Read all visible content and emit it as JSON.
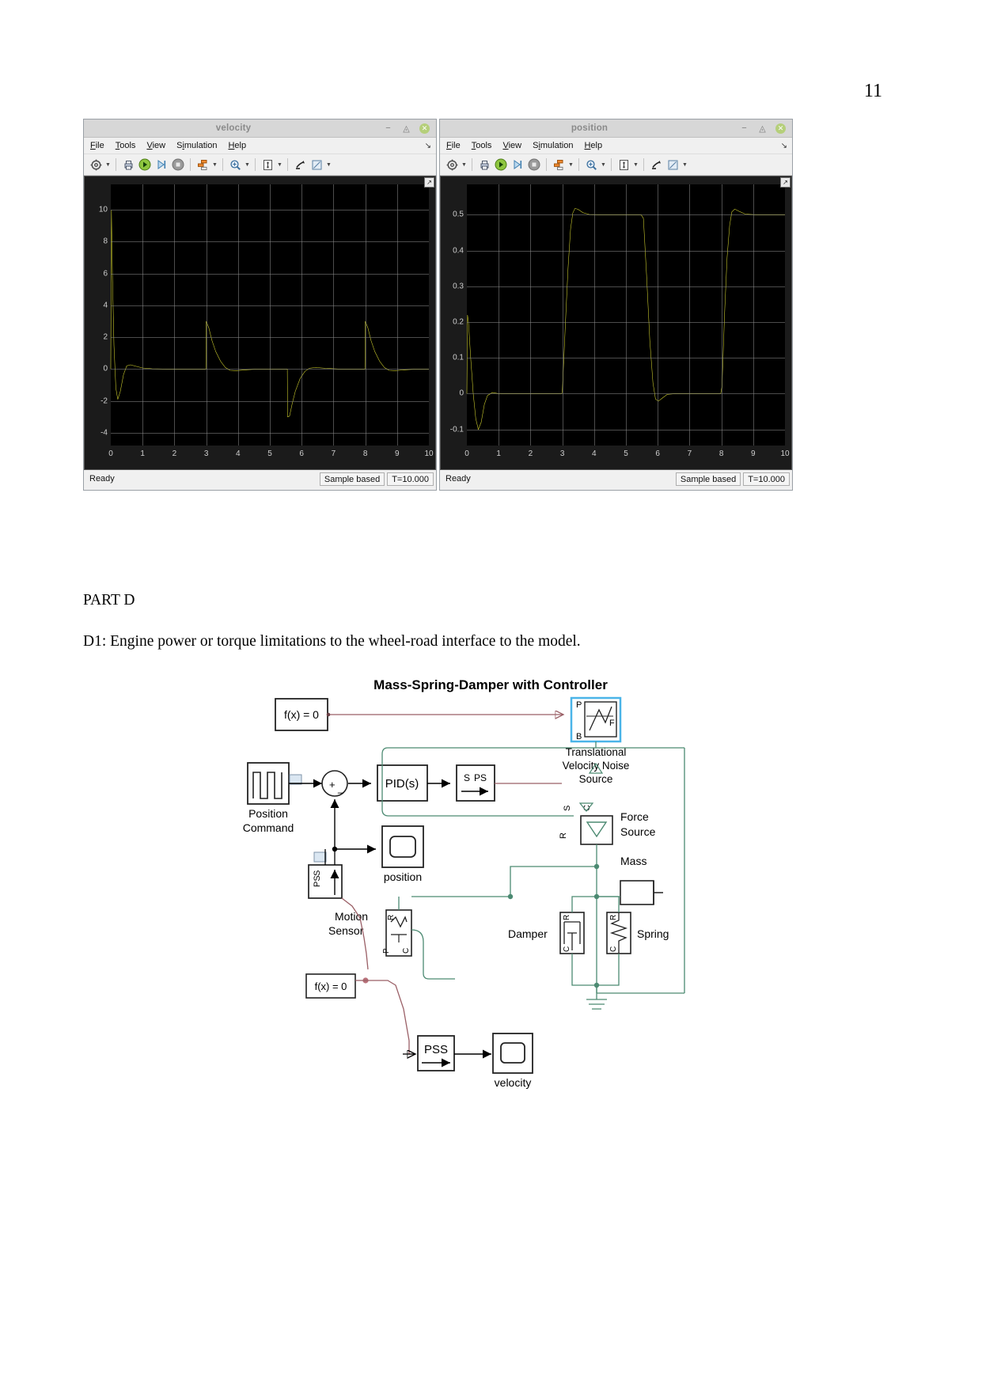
{
  "page": {
    "number": "11"
  },
  "document": {
    "part_heading": "PART D",
    "d1_text": "D1: Engine power or torque limitations to the wheel-road interface to the model."
  },
  "scopes": [
    {
      "id": "velocity",
      "title": "velocity",
      "menu": [
        "File",
        "Tools",
        "View",
        "Simulation",
        "Help"
      ],
      "toolbar_icons": [
        "settings-gear-icon",
        "print-icon",
        "run-icon",
        "step-forward-icon",
        "stop-icon",
        "layout-icon",
        "zoom-in-icon",
        "autoscale-icon",
        "cursor-measure-icon",
        "measurement-icon"
      ],
      "status": {
        "ready": "Ready",
        "sample_mode": "Sample based",
        "time": "T=10.000"
      },
      "window_buttons": [
        "minimize",
        "restore",
        "close"
      ],
      "chart_data": {
        "type": "line",
        "title": "velocity",
        "xlabel": "",
        "ylabel": "",
        "xlim": [
          0,
          10
        ],
        "ylim": [
          -4.8,
          11.6
        ],
        "xticks": [
          0,
          1,
          2,
          3,
          4,
          5,
          6,
          7,
          8,
          9,
          10
        ],
        "yticks": [
          -4,
          -2,
          0,
          2,
          4,
          6,
          8,
          10
        ],
        "grid": true,
        "line_color": "#d8d830",
        "background": "#000000",
        "series": [
          {
            "name": "velocity",
            "points": [
              [
                0.0,
                0.0
              ],
              [
                0.02,
                10.0
              ],
              [
                0.05,
                6.0
              ],
              [
                0.1,
                1.5
              ],
              [
                0.16,
                -1.2
              ],
              [
                0.22,
                -1.9
              ],
              [
                0.3,
                -1.4
              ],
              [
                0.4,
                -0.35
              ],
              [
                0.5,
                0.2
              ],
              [
                0.62,
                0.27
              ],
              [
                0.78,
                0.18
              ],
              [
                1.0,
                0.07
              ],
              [
                1.3,
                0.02
              ],
              [
                1.8,
                0.0
              ],
              [
                2.5,
                0.0
              ],
              [
                2.99,
                0.0
              ],
              [
                3.0,
                3.0
              ],
              [
                3.08,
                2.6
              ],
              [
                3.18,
                1.8
              ],
              [
                3.3,
                1.1
              ],
              [
                3.45,
                0.5
              ],
              [
                3.6,
                0.1
              ],
              [
                3.75,
                -0.08
              ],
              [
                3.95,
                -0.1
              ],
              [
                4.2,
                -0.05
              ],
              [
                4.6,
                0.0
              ],
              [
                5.4,
                0.0
              ],
              [
                5.55,
                0.0
              ],
              [
                5.56,
                -3.0
              ],
              [
                5.62,
                -2.95
              ],
              [
                5.7,
                -2.2
              ],
              [
                5.8,
                -1.4
              ],
              [
                5.95,
                -0.6
              ],
              [
                6.1,
                -0.15
              ],
              [
                6.25,
                0.06
              ],
              [
                6.45,
                0.1
              ],
              [
                6.75,
                0.05
              ],
              [
                7.2,
                0.0
              ],
              [
                7.9,
                0.0
              ],
              [
                7.99,
                0.0
              ],
              [
                8.0,
                3.0
              ],
              [
                8.08,
                2.6
              ],
              [
                8.18,
                1.8
              ],
              [
                8.3,
                1.1
              ],
              [
                8.45,
                0.5
              ],
              [
                8.6,
                0.1
              ],
              [
                8.75,
                -0.08
              ],
              [
                8.95,
                -0.1
              ],
              [
                9.2,
                -0.05
              ],
              [
                9.6,
                0.0
              ],
              [
                10.0,
                0.0
              ]
            ]
          }
        ]
      }
    },
    {
      "id": "position",
      "title": "position",
      "menu": [
        "File",
        "Tools",
        "View",
        "Simulation",
        "Help"
      ],
      "toolbar_icons": [
        "settings-gear-icon",
        "print-icon",
        "run-icon",
        "step-forward-icon",
        "stop-icon",
        "layout-icon",
        "zoom-in-icon",
        "autoscale-icon",
        "cursor-measure-icon",
        "measurement-icon"
      ],
      "status": {
        "ready": "Ready",
        "sample_mode": "Sample based",
        "time": "T=10.000"
      },
      "window_buttons": [
        "minimize",
        "restore",
        "close"
      ],
      "chart_data": {
        "type": "line",
        "title": "position",
        "xlabel": "",
        "ylabel": "",
        "xlim": [
          0,
          10
        ],
        "ylim": [
          -0.145,
          0.585
        ],
        "xticks": [
          0,
          1,
          2,
          3,
          4,
          5,
          6,
          7,
          8,
          9,
          10
        ],
        "yticks": [
          -0.1,
          0,
          0.1,
          0.2,
          0.3,
          0.4,
          0.5
        ],
        "grid": true,
        "line_color": "#d8d830",
        "background": "#000000",
        "series": [
          {
            "name": "position",
            "points": [
              [
                0.0,
                0.0
              ],
              [
                0.02,
                0.22
              ],
              [
                0.05,
                0.2
              ],
              [
                0.12,
                0.1
              ],
              [
                0.2,
                0.0
              ],
              [
                0.28,
                -0.07
              ],
              [
                0.36,
                -0.1
              ],
              [
                0.45,
                -0.08
              ],
              [
                0.55,
                -0.03
              ],
              [
                0.65,
                -0.005
              ],
              [
                0.8,
                0.003
              ],
              [
                1.0,
                0.0
              ],
              [
                1.5,
                0.0
              ],
              [
                2.5,
                0.0
              ],
              [
                2.98,
                0.0
              ],
              [
                3.0,
                0.005
              ],
              [
                3.1,
                0.2
              ],
              [
                3.18,
                0.35
              ],
              [
                3.26,
                0.46
              ],
              [
                3.33,
                0.505
              ],
              [
                3.4,
                0.518
              ],
              [
                3.5,
                0.515
              ],
              [
                3.65,
                0.506
              ],
              [
                3.85,
                0.501
              ],
              [
                4.2,
                0.5
              ],
              [
                5.0,
                0.5
              ],
              [
                5.48,
                0.5
              ],
              [
                5.55,
                0.49
              ],
              [
                5.65,
                0.33
              ],
              [
                5.75,
                0.15
              ],
              [
                5.85,
                0.03
              ],
              [
                5.93,
                -0.015
              ],
              [
                6.02,
                -0.021
              ],
              [
                6.15,
                -0.012
              ],
              [
                6.3,
                -0.002
              ],
              [
                6.55,
                0.0
              ],
              [
                7.2,
                0.0
              ],
              [
                7.98,
                0.0
              ],
              [
                8.02,
                0.02
              ],
              [
                8.1,
                0.22
              ],
              [
                8.18,
                0.38
              ],
              [
                8.26,
                0.47
              ],
              [
                8.33,
                0.508
              ],
              [
                8.42,
                0.516
              ],
              [
                8.55,
                0.51
              ],
              [
                8.75,
                0.502
              ],
              [
                9.1,
                0.5
              ],
              [
                9.6,
                0.5
              ],
              [
                10.0,
                0.5
              ]
            ]
          }
        ]
      }
    }
  ],
  "diagram": {
    "title_plain": "Mass-Spring-Damper",
    "title_suffix": " with Controller",
    "blocks": {
      "fx_top": "f(x) = 0",
      "fx_bottom": "f(x) = 0",
      "position_command": "Position\nCommand",
      "position_command_line1": "Position",
      "position_command_line2": "Command",
      "sum_plus": "+",
      "sum_minus": "_",
      "pid": "PID(s)",
      "simu_ps_s": "S",
      "simu_ps_ps": "PS",
      "trans_vel_noise_1": "Translational",
      "trans_vel_noise_2": "Velocity Noise",
      "trans_vel_noise_3": "Source",
      "port_p": "P",
      "port_b": "B",
      "port_f": "F",
      "force_source_1": "Force",
      "force_source_2": "Source",
      "mass": "Mass",
      "damper": "Damper",
      "spring": "Spring",
      "motion_sensor_1": "Motion",
      "motion_sensor_2": "Sensor",
      "ps_s": "PS",
      "ps_s2": "S",
      "pss": "PSS",
      "scope_position": "position",
      "scope_velocity": "velocity",
      "node_s": "S",
      "node_c": "C",
      "node_r": "R"
    },
    "colors": {
      "physical_line": "#4c8a72",
      "signal_line": "#000000",
      "sensor_line": "#9a5f66",
      "highlight": "#4ab4e8"
    }
  }
}
